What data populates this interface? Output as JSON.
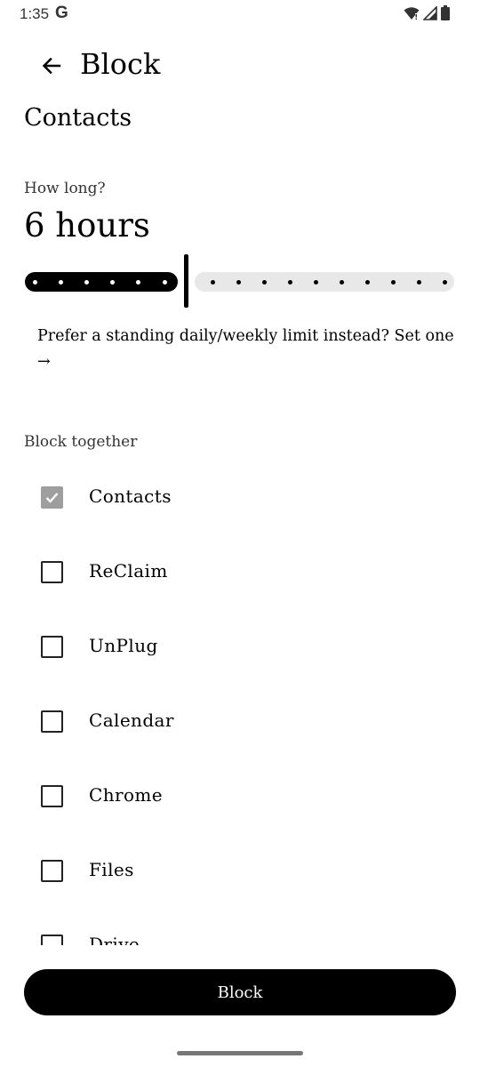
{
  "status_bar": {
    "time": "1:35",
    "g_logo": "G",
    "icons": [
      "wifi-icon",
      "signal-icon",
      "battery-icon"
    ]
  },
  "header": {
    "title": "Block"
  },
  "app_name": "Contacts",
  "duration": {
    "label": "How long?",
    "value": "6 hours",
    "slider_fraction": 0.375
  },
  "hint_link": "Prefer a standing daily/weekly limit instead? Set one →",
  "block_together": {
    "label": "Block together",
    "items": [
      {
        "label": "Contacts",
        "checked": true
      },
      {
        "label": "ReClaim",
        "checked": false
      },
      {
        "label": "UnPlug",
        "checked": false
      },
      {
        "label": "Calendar",
        "checked": false
      },
      {
        "label": "Chrome",
        "checked": false
      },
      {
        "label": "Files",
        "checked": false
      },
      {
        "label": "Drive",
        "checked": false
      }
    ]
  },
  "primary_button": "Block"
}
